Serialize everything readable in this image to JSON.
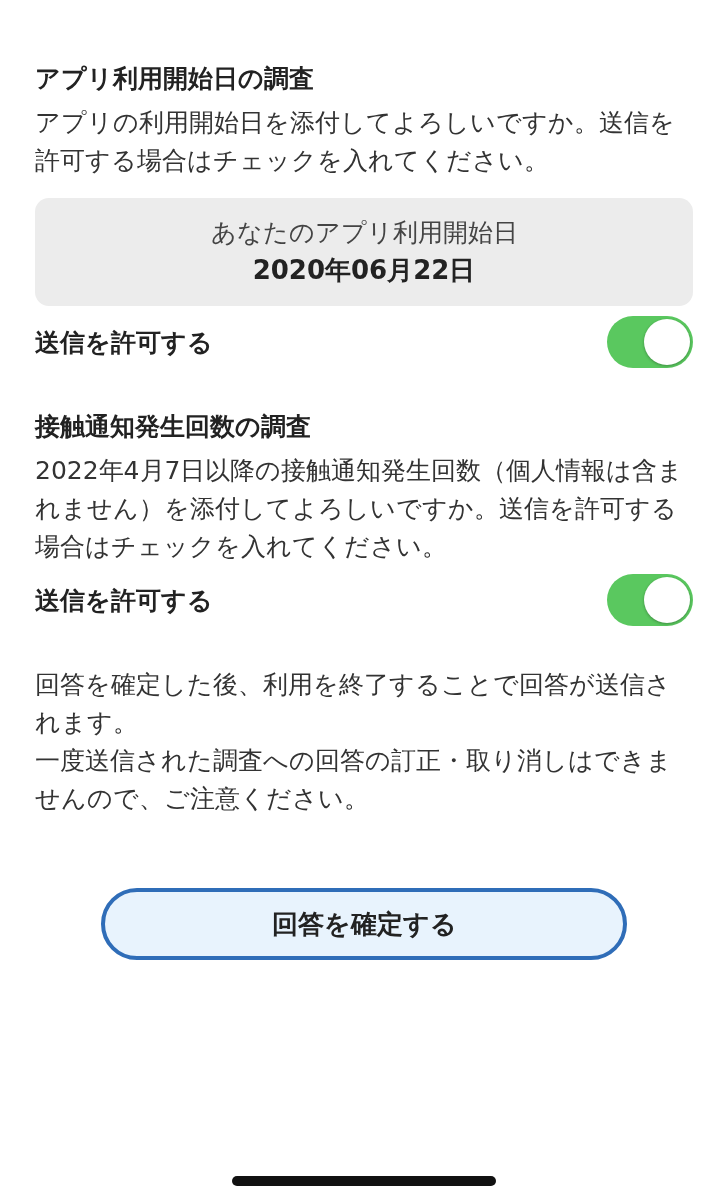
{
  "sections": [
    {
      "title": "アプリ利用開始日の調査",
      "description": "アプリの利用開始日を添付してよろしいですか。送信を許可する場合はチェックを入れてください。",
      "info_card": {
        "label": "あなたのアプリ利用開始日",
        "value": "2020年06月22日"
      },
      "toggle": {
        "label": "送信を許可する",
        "on": true
      }
    },
    {
      "title": "接触通知発生回数の調査",
      "description": "2022年4月7日以降の接触通知発生回数（個人情報は含まれません）を添付してよろしいですか。送信を許可する場合はチェックを入れてください。",
      "toggle": {
        "label": "送信を許可する",
        "on": true
      }
    }
  ],
  "notes": [
    "回答を確定した後、利用を終了することで回答が送信されます。",
    "一度送信された調査への回答の訂正・取り消しはできませんので、ご注意ください。"
  ],
  "confirm_button": "回答を確定する"
}
